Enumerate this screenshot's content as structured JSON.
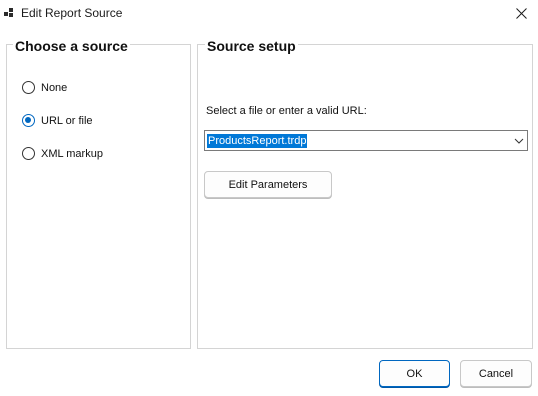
{
  "window": {
    "title": "Edit Report Source"
  },
  "icons": {
    "app": "report-window-icon",
    "close": "close-icon",
    "dropdown": "chevron-down-icon"
  },
  "source_group": {
    "title": "Choose a source",
    "options": [
      {
        "label": "None",
        "selected": false
      },
      {
        "label": "URL or file",
        "selected": true
      },
      {
        "label": "XML markup",
        "selected": false
      }
    ]
  },
  "setup_group": {
    "title": "Source setup",
    "field_label": "Select a file or enter a valid URL:",
    "field_value": "ProductsReport.trdp",
    "edit_parameters_label": "Edit Parameters"
  },
  "footer": {
    "ok_label": "OK",
    "cancel_label": "Cancel"
  },
  "colors": {
    "accent": "#0067c0",
    "selection": "#0078d7"
  }
}
